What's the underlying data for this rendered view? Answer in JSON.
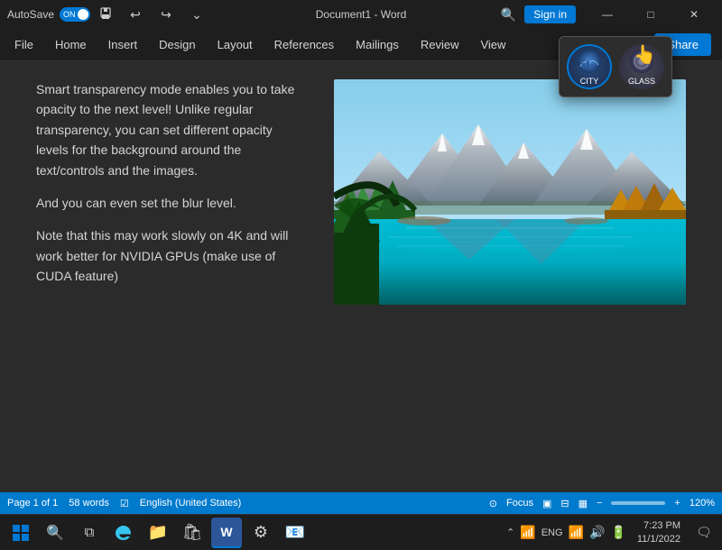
{
  "titlebar": {
    "autosave_label": "AutoSave",
    "toggle_state": "ON",
    "document_name": "Document1 - Word",
    "signin_label": "Sign in",
    "undo_icon": "↩",
    "redo_icon": "↪",
    "more_icon": "⌄",
    "search_icon": "🔍",
    "minimize_icon": "—",
    "maximize_icon": "□",
    "close_icon": "✕"
  },
  "menubar": {
    "items": [
      "File",
      "Home",
      "Insert",
      "Design",
      "Layout",
      "References",
      "Mailings",
      "Review",
      "View"
    ],
    "share_label": "Share"
  },
  "theme_switcher": {
    "city_label": "CITY",
    "glass_label": "GLASS"
  },
  "document": {
    "paragraph1": "Smart transparency mode enables you to take opacity to the next level! Unlike regular transparency, you can set different opacity levels for the background around the text/controls and the images.",
    "paragraph2": "And you can even set the blur level.",
    "paragraph3": "Note that this may work slowly on 4K and will work better for NVIDIA GPUs (make use of CUDA feature)"
  },
  "statusbar": {
    "page_info": "Page 1 of 1",
    "word_count": "58 words",
    "language": "English (United States)",
    "focus_label": "Focus",
    "zoom_level": "120%"
  },
  "taskbar": {
    "windows_icon": "⊞",
    "search_icon": "🔍",
    "task_view_icon": "❑",
    "edge_icon": "e",
    "explorer_icon": "📁",
    "store_icon": "🛍",
    "word_icon": "W",
    "settings_icon": "⚙",
    "outlook_icon": "O",
    "show_hidden_icon": "⌃",
    "weather_text": "",
    "eng_label": "ENG",
    "wifi_icon": "📶",
    "volume_icon": "🔊",
    "battery_icon": "🔋",
    "time": "7:23 PM",
    "date": "11/1/2022",
    "notification_icon": "🗨"
  }
}
